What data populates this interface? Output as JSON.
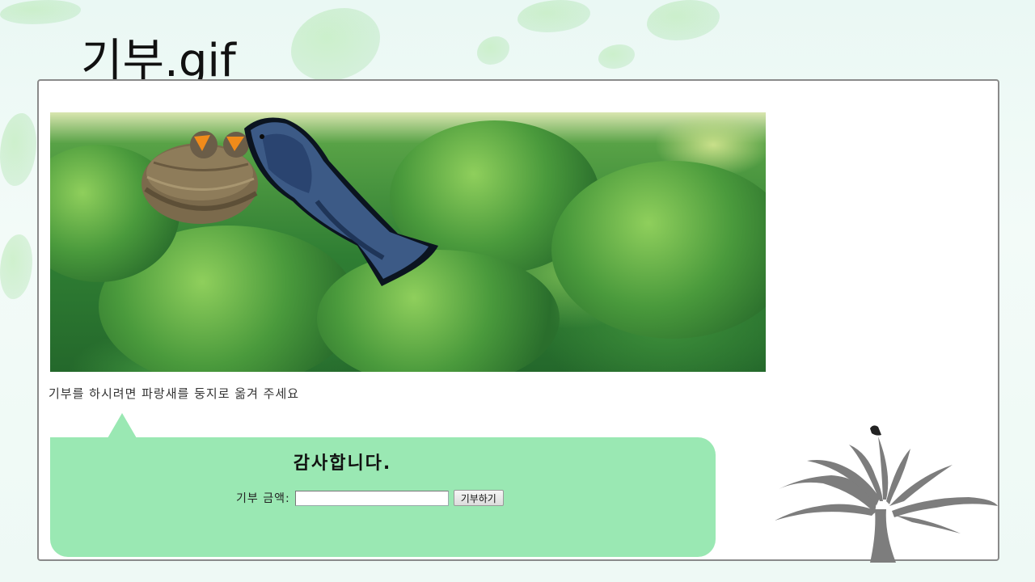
{
  "slide": {
    "title": "기부.gif"
  },
  "game": {
    "instruction": "기부를 하시려면 파랑새를 둥지로 옮겨 주세요",
    "icons": {
      "bird": "bluebird-icon",
      "nest": "nest-icon",
      "tree": "bare-tree-icon"
    }
  },
  "donation": {
    "thanks": "감사합니다.",
    "amount_label": "기부 금액:",
    "amount_value": "",
    "submit_label": "기부하기"
  },
  "colors": {
    "bubble": "#9ae8b3",
    "bird_blue": "#3c5a86",
    "foliage": "#3d8f3a"
  }
}
